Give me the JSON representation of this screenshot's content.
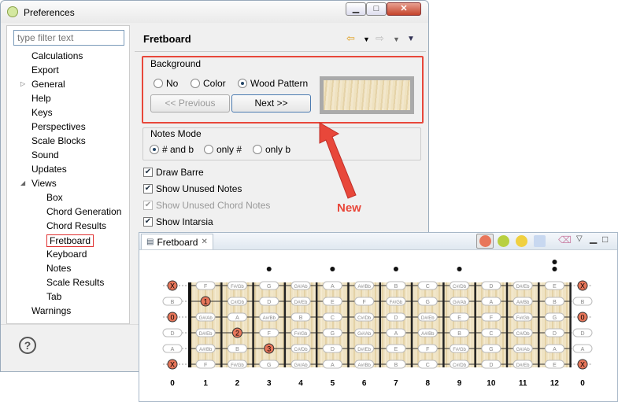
{
  "window": {
    "title": "Preferences"
  },
  "filter": {
    "placeholder": "type filter text"
  },
  "tree": [
    {
      "label": "Calculations",
      "level": 0
    },
    {
      "label": "Export",
      "level": 0
    },
    {
      "label": "General",
      "level": 0,
      "twisty": "closed"
    },
    {
      "label": "Help",
      "level": 0
    },
    {
      "label": "Keys",
      "level": 0
    },
    {
      "label": "Perspectives",
      "level": 0
    },
    {
      "label": "Scale Blocks",
      "level": 0
    },
    {
      "label": "Sound",
      "level": 0
    },
    {
      "label": "Updates",
      "level": 0
    },
    {
      "label": "Views",
      "level": 0,
      "twisty": "open"
    },
    {
      "label": "Box",
      "level": 1
    },
    {
      "label": "Chord Generation",
      "level": 1
    },
    {
      "label": "Chord Results",
      "level": 1
    },
    {
      "label": "Fretboard",
      "level": 1,
      "selected": true
    },
    {
      "label": "Keyboard",
      "level": 1
    },
    {
      "label": "Notes",
      "level": 1
    },
    {
      "label": "Scale Results",
      "level": 1
    },
    {
      "label": "Tab",
      "level": 1
    },
    {
      "label": "Warnings",
      "level": 0
    }
  ],
  "page": {
    "title": "Fretboard"
  },
  "background": {
    "group_label": "Background",
    "options": [
      "No",
      "Color",
      "Wood Pattern"
    ],
    "selected": "Wood Pattern",
    "prev_label": "<< Previous",
    "next_label": "Next >>"
  },
  "notes_mode": {
    "group_label": "Notes Mode",
    "options": [
      "# and b",
      "only #",
      "only b"
    ],
    "selected": "# and b"
  },
  "checkboxes": [
    {
      "label": "Draw Barre",
      "checked": true,
      "enabled": true
    },
    {
      "label": "Show Unused Notes",
      "checked": true,
      "enabled": true
    },
    {
      "label": "Show Unused Chord Notes",
      "checked": true,
      "enabled": false
    },
    {
      "label": "Show Intarsia",
      "checked": true,
      "enabled": true
    }
  ],
  "annotation": {
    "label": "New",
    "color": "#e8473a"
  },
  "fretboard_view": {
    "tab_label": "Fretboard",
    "fret_numbers": [
      "0",
      "1",
      "2",
      "3",
      "4",
      "5",
      "6",
      "7",
      "8",
      "9",
      "10",
      "11",
      "12",
      "0"
    ],
    "strings": [
      [
        "F",
        "F#/Gb",
        "G",
        "G#/Ab",
        "A",
        "A#/Bb",
        "B",
        "C",
        "C#/Db",
        "D",
        "D#/Eb",
        "E"
      ],
      [
        "C",
        "C#/Db",
        "D",
        "D#/Eb",
        "E",
        "F",
        "F#/Gb",
        "G",
        "G#/Ab",
        "A",
        "A#/Bb",
        "B"
      ],
      [
        "G#/Ab",
        "A",
        "A#/Bb",
        "B",
        "C",
        "C#/Db",
        "D",
        "D#/Eb",
        "E",
        "F",
        "F#/Gb",
        "G"
      ],
      [
        "D#/Eb",
        "E",
        "F",
        "F#/Gb",
        "G",
        "G#/Ab",
        "A",
        "A#/Bb",
        "B",
        "C",
        "C#/Db",
        "D"
      ],
      [
        "A#/Bb",
        "B",
        "C",
        "C#/Db",
        "D",
        "D#/Eb",
        "E",
        "F",
        "F#/Gb",
        "G",
        "G#/Ab",
        "A"
      ],
      [
        "F",
        "F#/Gb",
        "G",
        "G#/Ab",
        "A",
        "A#/Bb",
        "B",
        "C",
        "C#/Db",
        "D",
        "D#/Eb",
        "E"
      ]
    ],
    "open_left": [
      "X",
      "B",
      "0",
      "D",
      "A",
      "X"
    ],
    "open_right": [
      "X",
      "B",
      "0",
      "D",
      "A",
      "X"
    ],
    "fingered": [
      {
        "string": 1,
        "fret": 1,
        "label": "1"
      },
      {
        "string": 3,
        "fret": 2,
        "label": "2"
      },
      {
        "string": 4,
        "fret": 3,
        "label": "3"
      }
    ]
  }
}
